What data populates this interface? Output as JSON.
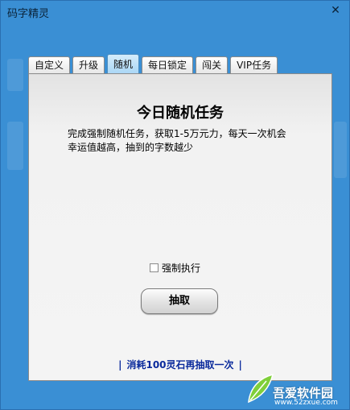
{
  "window": {
    "title": "码字精灵"
  },
  "tabs": [
    {
      "label": "自定义",
      "active": false
    },
    {
      "label": "升级",
      "active": false
    },
    {
      "label": "随机",
      "active": true
    },
    {
      "label": "每日锁定",
      "active": false
    },
    {
      "label": "闯关",
      "active": false
    },
    {
      "label": "VIP任务",
      "active": false
    }
  ],
  "panel": {
    "title": "今日随机任务",
    "description_line1": "完成强制随机任务，获取1-5万元力，每天一次机会",
    "description_line2": "幸运值越高，抽到的字数越少",
    "force_label": "强制执行",
    "force_checked": false,
    "draw_button": "抽取",
    "redraw_text": "消耗100灵石再抽取一次",
    "redraw_bar": "|"
  },
  "watermark": {
    "name": "吾爱软件园",
    "url": "www.52zxue.com"
  },
  "colors": {
    "frame": "#3a8fd4",
    "active_tab": "#a9d6f5",
    "link": "#0a2a9c"
  }
}
